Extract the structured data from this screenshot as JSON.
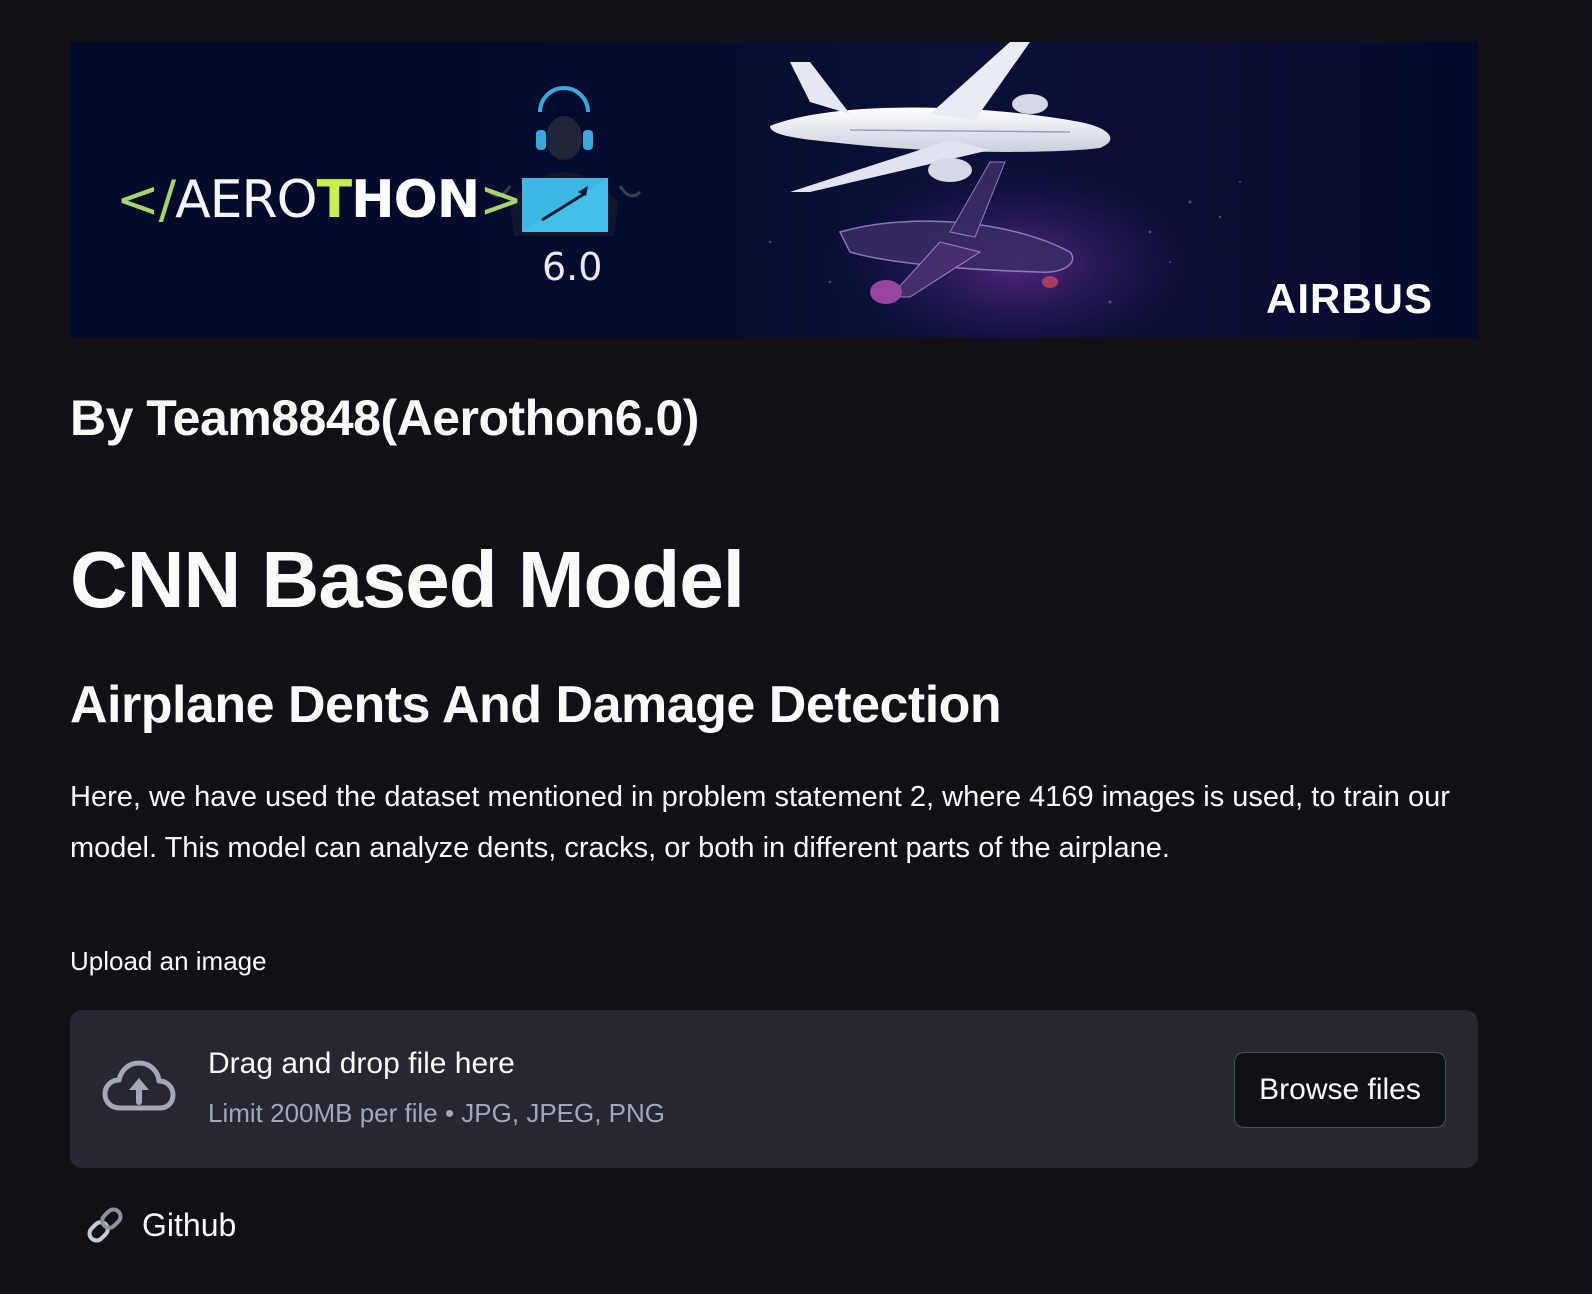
{
  "banner": {
    "logo_open": "</",
    "logo_aero": "AERO",
    "logo_thon_t": "T",
    "logo_thon_rest": "HON",
    "logo_close": ">",
    "version": "6.0",
    "brand": "AIRBUS",
    "colors": {
      "background": "#020a2a",
      "accent_green": "#a5d66c",
      "accent_lime": "#c9f04a",
      "tile_blue": "#3db7e4"
    }
  },
  "header": {
    "team": "By Team8848(Aerothon6.0)"
  },
  "main": {
    "title": "CNN Based Model",
    "subtitle": "Airplane Dents And Damage Detection",
    "description": "Here, we have used the dataset mentioned in problem statement 2, where 4169 images is used, to train our model. This model can analyze dents, cracks, or both in different parts of the airplane."
  },
  "uploader": {
    "label": "Upload an image",
    "drop_text": "Drag and drop file here",
    "limit_text": "Limit 200MB per file • JPG, JPEG, PNG",
    "browse_label": "Browse files",
    "icon": "cloud-upload-icon"
  },
  "links": {
    "github_label": "Github",
    "icon": "link-icon"
  },
  "theme": {
    "background": "#0f1117",
    "surface": "#262730",
    "text": "#fafafa",
    "muted_text": "#a3a8b8"
  }
}
